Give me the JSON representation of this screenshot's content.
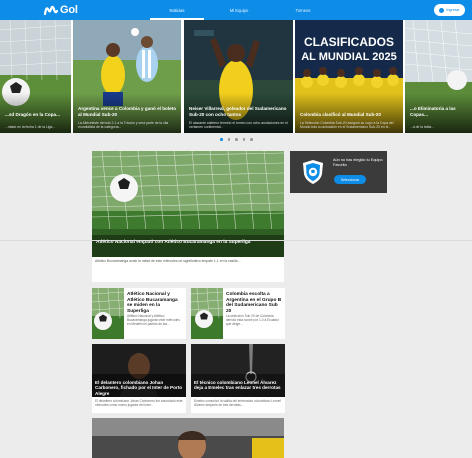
{
  "header": {
    "logo_text": "Gol",
    "nav": [
      {
        "label": "Noticias",
        "active": true
      },
      {
        "label": "Mi Equipo",
        "active": false
      },
      {
        "label": "Torneos",
        "active": false
      }
    ],
    "login_label": "Ingresar",
    "accent_color": "#0d8ce8"
  },
  "carousel": {
    "slides": [
      {
        "title": "...sd Dragón en la Copa...",
        "sub": "...ntado en la fecha 1 de la Liga..."
      },
      {
        "title": "Argentina vence a Colombia y ganó el boleto al Mundial Sub-20",
        "sub": "La Albiceleste derrotó 2-1 a la Tricolor y será parte de la cita mundialista de la categoría..."
      },
      {
        "title": "Neiser Villarreal, goleador del Sudamericano Sub-20 con ocho tantos",
        "sub": "El atacante cafetero terminó el torneo con ocho anotaciones en el certamen continental..."
      },
      {
        "title": "Colombia clasificó al Mundial Sub-20",
        "sub": "La Selección Colombia Sub-20 aseguró su cupo a la Copa del Mundo tras su actuación en el Sudamericano Sub-20 en el..."
      },
      {
        "title": "...o Eliminatoria a las Copas...",
        "sub": "...a de la tabla..."
      }
    ],
    "banner_text": "CLASIFICADOS AL MUNDIAL 2025",
    "dots": 5,
    "active_dot": 0
  },
  "featured": {
    "title": "Atlético Nacional empató con Atlético Bucaramanga en la Superliga",
    "desc": "Atlético Bucaramanga avaló la mitad de este miércoles un significativo empate 1-1 en la casilla ..."
  },
  "promo": {
    "text": "Aún no has elegido tu Equipo Favorito",
    "button": "Seleccionar"
  },
  "small_cards": [
    {
      "title": "Atlético Nacional y Atlético Bucaramanga se miden en la Superliga",
      "desc": "Atlético Nacional y Atlético Bucaramanga jugarán este miércoles en Medellín el partido de ida..."
    },
    {
      "title": "Colombia escolta a Argentina en el Grupo B del Sudamericano Sub 20",
      "desc": "La selección Sub 20 de Colombia derrotó esta noche por 1-0 a Ecuador que dirige..."
    }
  ],
  "medium_cards": [
    {
      "title": "El delantero colombiano Johan Carbonero, fichado por el Inter de Porto Alegre",
      "desc": "El delantero colombiano Johan Carbonero fue anunciado este miércoles como nuevo jugador del Inter..."
    },
    {
      "title": "El técnico colombiano Leonel Álvarez deja a Emelec tras enlazar tres derrotas",
      "desc": "Emelec comunicó la salida del entrenador colombiano Leonel Álvarez después de tres derrotas..."
    }
  ]
}
